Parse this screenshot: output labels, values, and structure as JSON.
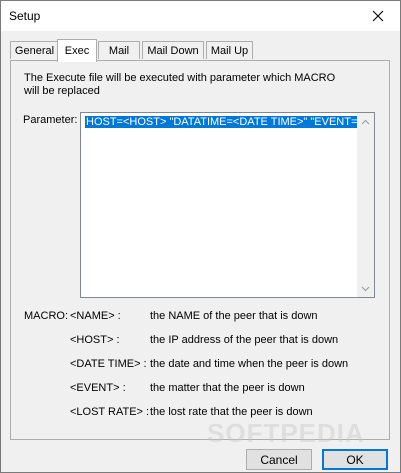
{
  "window": {
    "title": "Setup"
  },
  "tabs": [
    {
      "label": "General",
      "active": false
    },
    {
      "label": "Exec",
      "active": true
    },
    {
      "label": "Mail",
      "active": false
    },
    {
      "label": "Mail Down",
      "active": false
    },
    {
      "label": "Mail Up",
      "active": false
    }
  ],
  "exec": {
    "description_line1": "The Execute file  will be executed with parameter which MACRO",
    "description_line2": "will be replaced",
    "parameter_label": "Parameter:",
    "parameter_value": "HOST=<HOST> \"DATATIME=<DATE TIME>\" \"EVENT=<EVENT>\""
  },
  "macros": {
    "label": "MACRO:",
    "rows": [
      {
        "name": "<NAME> :",
        "desc": "the NAME of the peer that is down"
      },
      {
        "name": "<HOST> :",
        "desc": "the IP address of the peer that is down"
      },
      {
        "name": "<DATE TIME> :",
        "desc": "the date and time when the peer is down"
      },
      {
        "name": "<EVENT> :",
        "desc": "the matter that the peer is down"
      },
      {
        "name": "<LOST RATE> :",
        "desc": "the lost rate that the peer is down"
      }
    ]
  },
  "buttons": {
    "cancel": "Cancel",
    "ok": "OK"
  },
  "watermark": "SOFTPEDIA"
}
